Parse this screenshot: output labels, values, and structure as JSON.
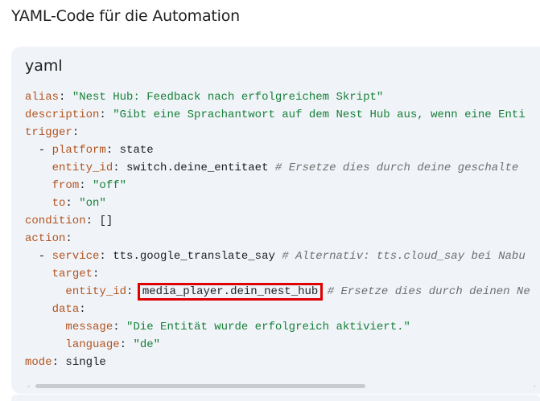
{
  "page": {
    "heading": "YAML-Code für die Automation"
  },
  "code_block": {
    "language": "yaml",
    "lines": [
      {
        "key": "alias",
        "sep": ": ",
        "value": "\"Nest Hub: Feedback nach erfolgreichem Skript\""
      },
      {
        "key": "description",
        "sep": ": ",
        "value": "\"Gibt eine Sprachantwort auf dem Nest Hub aus, wenn eine Enti"
      },
      {
        "key": "trigger",
        "sep": ":"
      },
      {
        "dash": "  - ",
        "key": "platform",
        "sep": ": ",
        "plain": "state"
      },
      {
        "indent": "    ",
        "key": "entity_id",
        "sep": ": ",
        "plain": "switch.deine_entitaet",
        "comment": " # Ersetze dies durch deine geschalte"
      },
      {
        "indent": "    ",
        "key": "from",
        "sep": ": ",
        "value": "\"off\""
      },
      {
        "indent": "    ",
        "key": "to",
        "sep": ": ",
        "value": "\"on\""
      },
      {
        "key": "condition",
        "sep": ": ",
        "plain": "[]"
      },
      {
        "key": "action",
        "sep": ":"
      },
      {
        "dash": "  - ",
        "key": "service",
        "sep": ": ",
        "plain": "tts.google_translate_say",
        "comment": " # Alternativ: tts.cloud_say bei Nabu"
      },
      {
        "indent": "    ",
        "key": "target",
        "sep": ":"
      },
      {
        "indent": "      ",
        "key": "entity_id",
        "sep": ": ",
        "highlight": "media_player.dein_nest_hub",
        "comment": " # Ersetze dies durch deinen Ne"
      },
      {
        "indent": "    ",
        "key": "data",
        "sep": ":"
      },
      {
        "indent": "      ",
        "key": "message",
        "sep": ": ",
        "value": "\"Die Entität wurde erfolgreich aktiviert.\""
      },
      {
        "indent": "      ",
        "key": "language",
        "sep": ": ",
        "value": "\"de\""
      },
      {
        "key": "mode",
        "sep": ": ",
        "plain": "single"
      }
    ]
  },
  "scrollbar": {
    "left_arrow": "‹",
    "right_arrow": "›"
  },
  "colors": {
    "key": "#b3541e",
    "string": "#188038",
    "comment": "#6f6f6f",
    "highlight_border": "#e00000",
    "code_background": "#f0f4f9"
  }
}
